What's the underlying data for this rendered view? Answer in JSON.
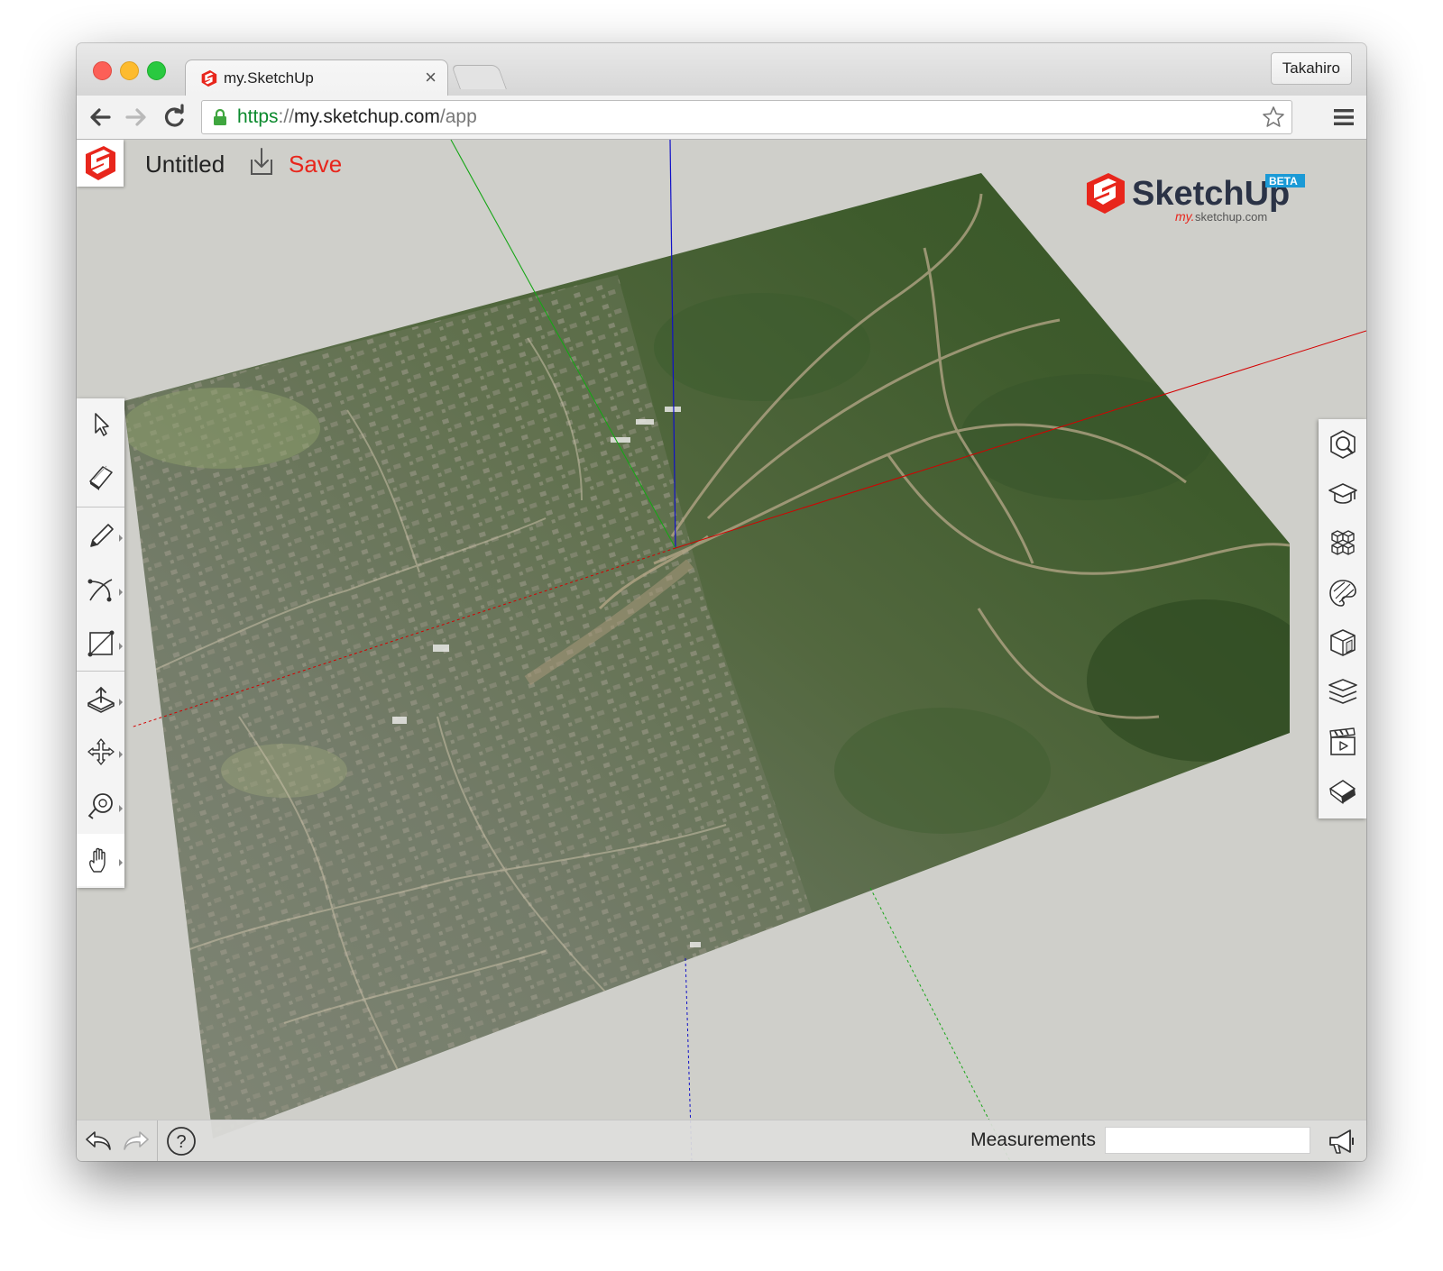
{
  "browser": {
    "tab_title": "my.SketchUp",
    "tab_close": "×",
    "profile_name": "Takahiro",
    "url": {
      "scheme": "https",
      "separator": "://",
      "host": "my.sketchup.com",
      "path": "/app"
    }
  },
  "app": {
    "document_title": "Untitled",
    "save_label": "Save",
    "brand": {
      "name": "SketchUp",
      "badge": "BETA",
      "subdomain": "my.",
      "domain": "sketchup.com"
    }
  },
  "left_toolbar": {
    "tools": [
      {
        "name": "select-tool",
        "icon": "arrow-cursor-icon"
      },
      {
        "name": "eraser-tool",
        "icon": "eraser-icon"
      },
      {
        "name": "pencil-tool",
        "icon": "pencil-icon"
      },
      {
        "name": "arc-tool",
        "icon": "arc-icon"
      },
      {
        "name": "rectangle-tool",
        "icon": "rectangle-icon"
      },
      {
        "name": "push-pull-tool",
        "icon": "push-pull-icon"
      },
      {
        "name": "move-tool",
        "icon": "move-icon"
      },
      {
        "name": "tape-measure-tool",
        "icon": "tape-measure-icon"
      },
      {
        "name": "pan-tool",
        "icon": "hand-icon",
        "active": true
      }
    ]
  },
  "right_toolbar": {
    "panels": [
      {
        "name": "entity-info-panel",
        "icon": "entity-info-icon"
      },
      {
        "name": "instructor-panel",
        "icon": "graduation-cap-icon"
      },
      {
        "name": "components-panel",
        "icon": "components-icon"
      },
      {
        "name": "materials-panel",
        "icon": "paint-palette-icon"
      },
      {
        "name": "styles-panel",
        "icon": "styles-cube-icon"
      },
      {
        "name": "layers-panel",
        "icon": "layers-icon"
      },
      {
        "name": "scenes-panel",
        "icon": "clapperboard-icon"
      },
      {
        "name": "display-panel",
        "icon": "display-eraser-icon"
      }
    ]
  },
  "statusbar": {
    "measurements_label": "Measurements",
    "measurements_value": "",
    "help_label": "?"
  },
  "colors": {
    "accent_red": "#e8261c",
    "axis_red": "#d40000",
    "axis_green": "#17a617",
    "axis_blue": "#1010c8",
    "https_green": "#0b8a2d",
    "viewport_bg": "#cfcfca"
  }
}
